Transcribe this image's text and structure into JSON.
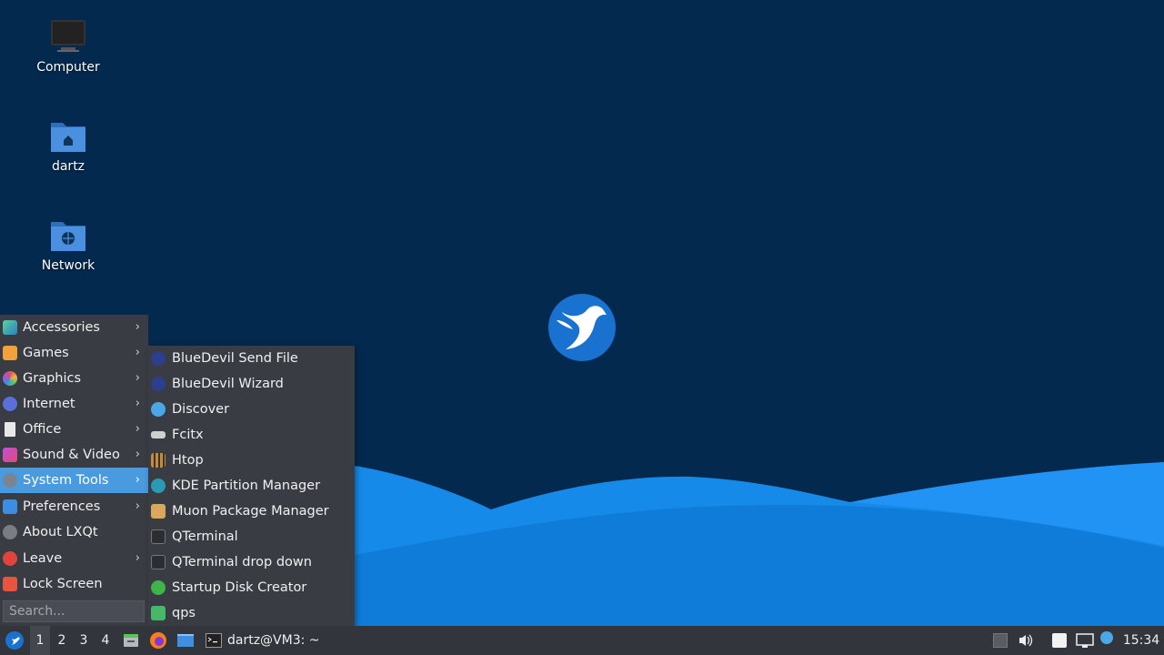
{
  "desktop": {
    "icons": [
      {
        "label": "Computer"
      },
      {
        "label": "dartz"
      },
      {
        "label": "Network"
      }
    ]
  },
  "menu": {
    "items": [
      {
        "label": "Accessories",
        "icon": "accessories-icon",
        "submenu": true
      },
      {
        "label": "Games",
        "icon": "games-icon",
        "submenu": true
      },
      {
        "label": "Graphics",
        "icon": "graphics-icon",
        "submenu": true
      },
      {
        "label": "Internet",
        "icon": "internet-icon",
        "submenu": true
      },
      {
        "label": "Office",
        "icon": "office-icon",
        "submenu": true
      },
      {
        "label": "Sound & Video",
        "icon": "sound-video-icon",
        "submenu": true
      },
      {
        "label": "System Tools",
        "icon": "system-tools-icon",
        "submenu": true,
        "active": true
      },
      {
        "label": "Preferences",
        "icon": "preferences-icon",
        "submenu": true
      },
      {
        "label": "About LXQt",
        "icon": "info-icon",
        "submenu": false
      },
      {
        "label": "Leave",
        "icon": "power-icon",
        "submenu": true
      },
      {
        "label": "Lock Screen",
        "icon": "lock-icon",
        "submenu": false
      }
    ],
    "search_placeholder": "Search..."
  },
  "submenu": {
    "items": [
      {
        "label": "BlueDevil Send File",
        "icon": "bluetooth-icon"
      },
      {
        "label": "BlueDevil Wizard",
        "icon": "bluetooth-icon"
      },
      {
        "label": "Discover",
        "icon": "discover-icon"
      },
      {
        "label": "Fcitx",
        "icon": "keyboard-icon"
      },
      {
        "label": "Htop",
        "icon": "htop-icon"
      },
      {
        "label": "KDE Partition Manager",
        "icon": "partition-icon"
      },
      {
        "label": "Muon Package Manager",
        "icon": "package-icon"
      },
      {
        "label": "QTerminal",
        "icon": "terminal-icon"
      },
      {
        "label": "QTerminal drop down",
        "icon": "terminal-icon"
      },
      {
        "label": "Startup Disk Creator",
        "icon": "usb-creator-icon"
      },
      {
        "label": "qps",
        "icon": "qps-icon"
      }
    ]
  },
  "taskbar": {
    "desktops": [
      "1",
      "2",
      "3",
      "4"
    ],
    "active_desktop": "1",
    "window_title": "dartz@VM3: ~",
    "clock": "15:34"
  },
  "colors": {
    "wallpaper": "#03294f",
    "wave_light": "#1e90f5",
    "menu_bg": "#3a3c44",
    "highlight": "#4a9ae0",
    "taskbar": "#33353c"
  }
}
